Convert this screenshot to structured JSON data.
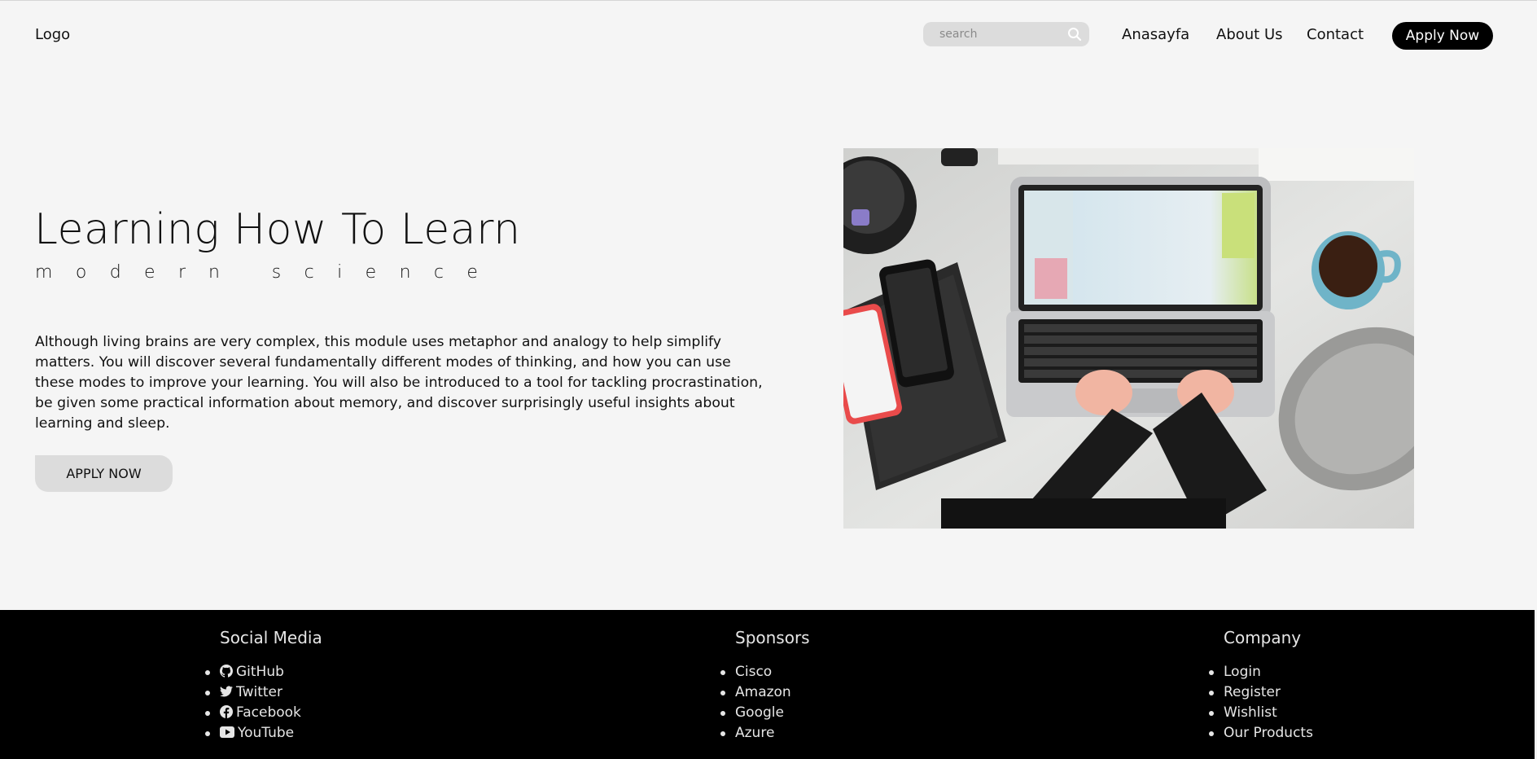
{
  "header": {
    "logo": "Logo",
    "search_placeholder": "search",
    "nav": [
      "Anasayfa",
      "About Us",
      "Contact"
    ],
    "apply_label": "Apply Now"
  },
  "hero": {
    "title": "Learning How To Learn",
    "subtitle": "modern science",
    "description": "Although living brains are very complex, this module uses metaphor and analogy to help simplify matters. You will discover several fundamentally different modes of thinking, and how you can use these modes to improve your learning. You will also be introduced to a tool for tackling procrastination, be given some practical information about memory, and discover surprisingly useful insights about learning and sleep.",
    "apply_label": "APPLY NOW"
  },
  "footer": {
    "social": {
      "heading": "Social Media",
      "items": [
        {
          "label": "GitHub",
          "icon": "github-icon"
        },
        {
          "label": "Twitter",
          "icon": "twitter-icon"
        },
        {
          "label": "Facebook",
          "icon": "facebook-icon"
        },
        {
          "label": "YouTube",
          "icon": "youtube-icon"
        }
      ]
    },
    "sponsors": {
      "heading": "Sponsors",
      "items": [
        "Cisco",
        "Amazon",
        "Google",
        "Azure"
      ]
    },
    "company": {
      "heading": "Company",
      "items": [
        "Login",
        "Register",
        "Wishlist",
        "Our Products"
      ]
    }
  },
  "colors": {
    "background": "#f5f5f5",
    "footer": "#000000",
    "button_dark": "#000000",
    "button_light": "#dcdcdc"
  }
}
